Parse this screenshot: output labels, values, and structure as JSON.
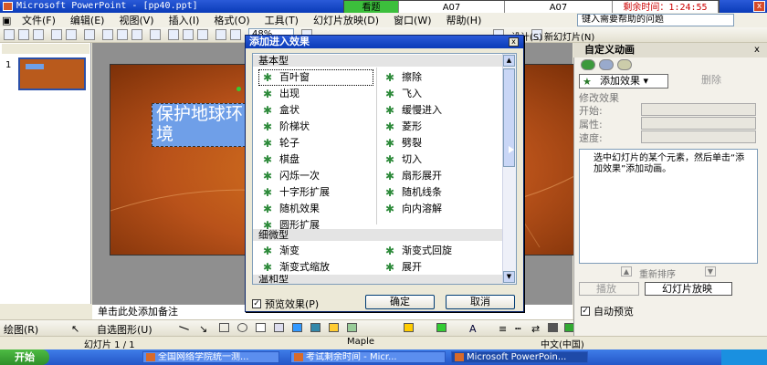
{
  "window": {
    "title": "Microsoft PowerPoint - [pp40.ppt]",
    "close_glyph": "x"
  },
  "exam": {
    "status": "看题",
    "area1": "A07",
    "area2": "A07",
    "timer": "剩余时间：1:24:55"
  },
  "menu": {
    "items": [
      "文件(F)",
      "编辑(E)",
      "视图(V)",
      "插入(I)",
      "格式(O)",
      "工具(T)",
      "幻灯片放映(D)",
      "窗口(W)",
      "帮助(H)"
    ],
    "help_placeholder": "键入需要帮助的问题"
  },
  "toolbar": {
    "zoom": "48%",
    "design": "设计(S)",
    "new_slide": "新幻灯片(N)"
  },
  "leftpane": {
    "slide_number": "1"
  },
  "slide": {
    "title_text": "保护地球环境"
  },
  "notes": {
    "placeholder": "单击此处添加备注"
  },
  "drawbar": {
    "draw": "绘图(R)",
    "autoshapes": "自选图形(U)"
  },
  "status": {
    "slide": "幻灯片 1 / 1",
    "design": "Maple",
    "language": "中文(中国)"
  },
  "taskbar": {
    "start": "开始",
    "tasks": [
      "全国网络学院统一测...",
      "考试剩余时间 - Micr...",
      "Microsoft PowerPoin..."
    ]
  },
  "taskpane": {
    "title": "自定义动画",
    "close_glyph": "x",
    "add_effect": "添加效果",
    "remove": "删除",
    "modify_heading": "修改效果",
    "start_label": "开始:",
    "property_label": "属性:",
    "speed_label": "速度:",
    "hint": "选中幻灯片的某个元素，然后单击“添加效果”添加动画。",
    "reorder": "重新排序",
    "play": "播放",
    "slide_show": "幻灯片放映",
    "auto_preview": "自动预览"
  },
  "dialog": {
    "title": "添加进入效果",
    "close_glyph": "x",
    "groups": [
      {
        "name": "基本型",
        "left": [
          "百叶窗",
          "出现",
          "盒状",
          "阶梯状",
          "轮子",
          "棋盘",
          "闪烁一次",
          "十字形扩展",
          "随机效果",
          "圆形扩展"
        ],
        "right": [
          "擦除",
          "飞入",
          "缓慢进入",
          "菱形",
          "劈裂",
          "切入",
          "扇形展开",
          "随机线条",
          "向内溶解"
        ]
      },
      {
        "name": "细微型",
        "left": [
          "渐变",
          "渐变式缩放"
        ],
        "right": [
          "渐变式回旋",
          "展开"
        ]
      },
      {
        "name": "温和型"
      }
    ],
    "selected": "百叶窗",
    "preview_label": "预览效果(P)",
    "ok": "确定",
    "cancel": "取消"
  },
  "colors": {
    "title_bar": "#0a3bb8",
    "slide_orange": "#d9791e",
    "effect_star": "#2d8a3a",
    "exam_green": "#3cbf3c",
    "timer_red": "#cc0000"
  }
}
